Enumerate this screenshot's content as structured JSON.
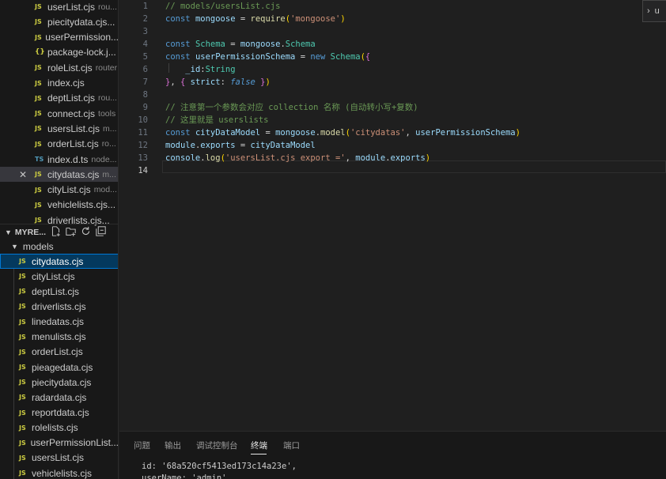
{
  "open_editors": [
    {
      "name": "userList.cjs",
      "desc": "rou...",
      "type": "JS"
    },
    {
      "name": "piecitydata.cjs...",
      "desc": "",
      "type": "JS"
    },
    {
      "name": "userPermission...",
      "desc": "",
      "type": "JS"
    },
    {
      "name": "package-lock.j...",
      "desc": "",
      "type": "{}"
    },
    {
      "name": "roleList.cjs",
      "desc": "router",
      "type": "JS"
    },
    {
      "name": "index.cjs",
      "desc": "",
      "type": "JS"
    },
    {
      "name": "deptList.cjs",
      "desc": "rou...",
      "type": "JS"
    },
    {
      "name": "connect.cjs",
      "desc": "tools",
      "type": "JS"
    },
    {
      "name": "usersList.cjs",
      "desc": "m...",
      "type": "JS"
    },
    {
      "name": "orderList.cjs",
      "desc": "ro...",
      "type": "JS"
    },
    {
      "name": "index.d.ts",
      "desc": "node...",
      "type": "TS"
    },
    {
      "name": "citydatas.cjs",
      "desc": "m...",
      "type": "JS",
      "close": "✕"
    },
    {
      "name": "cityList.cjs",
      "desc": "mod...",
      "type": "JS"
    },
    {
      "name": "vehiclelists.cjs...",
      "desc": "",
      "type": "JS"
    },
    {
      "name": "driverlists.cjs...",
      "desc": "",
      "type": "JS"
    }
  ],
  "explorer": {
    "section_title": "MYRE...",
    "folder": "models",
    "files": [
      "citydatas.cjs",
      "cityList.cjs",
      "deptList.cjs",
      "driverlists.cjs",
      "linedatas.cjs",
      "menulists.cjs",
      "orderList.cjs",
      "pieagedata.cjs",
      "piecitydata.cjs",
      "radardata.cjs",
      "reportdata.cjs",
      "rolelists.cjs",
      "userPermissionList...",
      "usersList.cjs",
      "vehiclelists.cjs"
    ],
    "file_icon_text": "JS"
  },
  "editor": {
    "line_numbers": [
      "1",
      "2",
      "3",
      "4",
      "5",
      "6",
      "7",
      "8",
      "9",
      "10",
      "11",
      "12",
      "13",
      "14"
    ],
    "current_line": 14
  },
  "find_widget": {
    "chevron": "›",
    "text": "u"
  },
  "panel": {
    "tabs": [
      "问题",
      "输出",
      "调试控制台",
      "终端",
      "端口"
    ],
    "active_tab": "终端",
    "terminal_lines": [
      "id: '68a520cf5413ed173c14a23e',",
      "userName: 'admin',"
    ]
  },
  "colors": {
    "accent": "#0078d4",
    "js_icon": "#cbcb41",
    "ts_icon": "#519aba",
    "editor_bg": "#1f1f1f",
    "sidebar_bg": "#181818"
  }
}
